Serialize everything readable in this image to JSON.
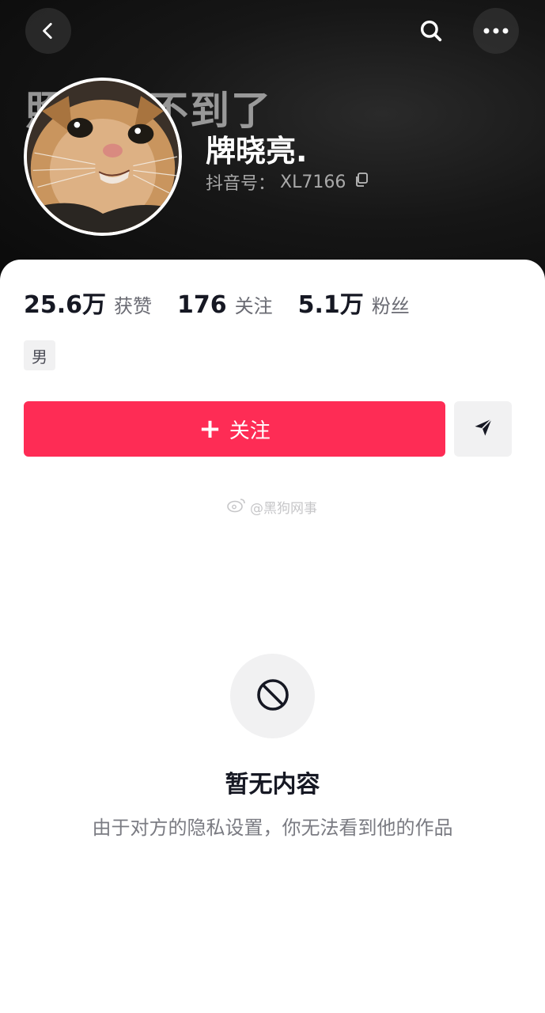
{
  "header": {
    "banner_text": "照片找不到了",
    "back_icon": "chevron-left-icon",
    "search_icon": "search-icon",
    "more_icon": "more-horizontal-icon"
  },
  "profile": {
    "avatar": "cat-avatar",
    "name": "牌晓亮.",
    "douyin_id_label": "抖音号：",
    "douyin_id_value": "XL7166",
    "copy_icon": "copy-icon"
  },
  "stats": [
    {
      "value": "25.6万",
      "label": "获赞"
    },
    {
      "value": "176",
      "label": "关注"
    },
    {
      "value": "5.1万",
      "label": "粉丝"
    }
  ],
  "gender": "男",
  "actions": {
    "follow_plus": "+",
    "follow_label": "关注",
    "share_icon": "send-icon"
  },
  "watermark": "@黑狗网事",
  "empty": {
    "icon": "block-icon",
    "title": "暂无内容",
    "description": "由于对方的隐私设置，你无法看到他的作品"
  },
  "colors": {
    "accent": "#fe2c55",
    "text_primary": "#161823",
    "text_secondary": "#6a6b73"
  }
}
